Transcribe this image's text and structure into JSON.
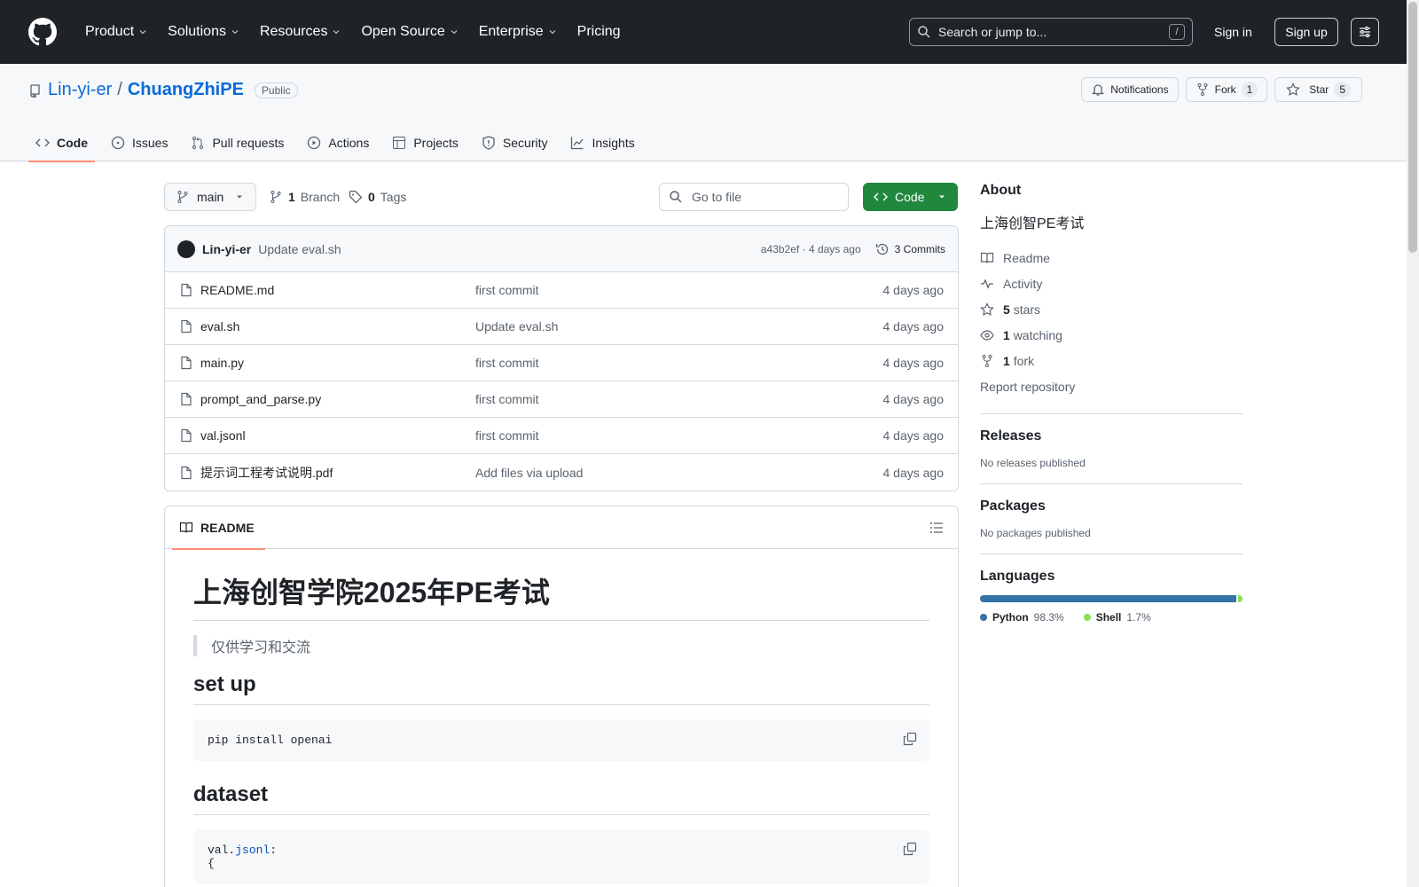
{
  "header": {
    "nav": [
      {
        "label": "Product",
        "dropdown": true
      },
      {
        "label": "Solutions",
        "dropdown": true
      },
      {
        "label": "Resources",
        "dropdown": true
      },
      {
        "label": "Open Source",
        "dropdown": true
      },
      {
        "label": "Enterprise",
        "dropdown": true
      },
      {
        "label": "Pricing",
        "dropdown": false
      }
    ],
    "search_placeholder": "Search or jump to...",
    "search_shortcut": "/",
    "signin": "Sign in",
    "signup": "Sign up"
  },
  "repo": {
    "owner": "Lin-yi-er",
    "separator": "/",
    "name": "ChuangZhiPE",
    "visibility": "Public",
    "notifications_label": "Notifications",
    "fork_label": "Fork",
    "fork_count": "1",
    "star_label": "Star",
    "star_count": "5",
    "tabs": [
      "Code",
      "Issues",
      "Pull requests",
      "Actions",
      "Projects",
      "Security",
      "Insights"
    ]
  },
  "toolbar": {
    "branch": "main",
    "branches_count": "1",
    "branches_label": "Branch",
    "tags_count": "0",
    "tags_label": "Tags",
    "goto_placeholder": "Go to file",
    "code_label": "Code"
  },
  "commit": {
    "author": "Lin-yi-er",
    "message": "Update eval.sh",
    "hash": "a43b2ef",
    "age": "· 4 days ago",
    "commits_label": "3 Commits"
  },
  "files": [
    {
      "name": "README.md",
      "message": "first commit",
      "age": "4 days ago"
    },
    {
      "name": "eval.sh",
      "message": "Update eval.sh",
      "age": "4 days ago"
    },
    {
      "name": "main.py",
      "message": "first commit",
      "age": "4 days ago"
    },
    {
      "name": "prompt_and_parse.py",
      "message": "first commit",
      "age": "4 days ago"
    },
    {
      "name": "val.jsonl",
      "message": "first commit",
      "age": "4 days ago"
    },
    {
      "name": "提示词工程考试说明.pdf",
      "message": "Add files via upload",
      "age": "4 days ago"
    }
  ],
  "readme": {
    "tab_label": "README",
    "h1": "上海创智学院2025年PE考试",
    "quote": "仅供学习和交流",
    "h2_setup": "set up",
    "code_setup": "pip install openai",
    "h2_dataset": "dataset",
    "code_dataset_prefix": "val.",
    "code_dataset_token": "jsonl",
    "code_dataset_suffix": ":",
    "code_dataset_line2": "{"
  },
  "sidebar": {
    "about_title": "About",
    "description": "上海创智PE考试",
    "readme": "Readme",
    "activity": "Activity",
    "stars_count": "5",
    "stars_label": "stars",
    "watching_count": "1",
    "watching_label": "watching",
    "fork_count": "1",
    "fork_label": "fork",
    "report": "Report repository",
    "releases_title": "Releases",
    "releases_empty": "No releases published",
    "packages_title": "Packages",
    "packages_empty": "No packages published",
    "languages_title": "Languages",
    "languages": [
      {
        "name": "Python",
        "percent": "98.3%",
        "value": 98.3,
        "color": "#3572A5"
      },
      {
        "name": "Shell",
        "percent": "1.7%",
        "value": 1.7,
        "color": "#89e051"
      }
    ]
  }
}
